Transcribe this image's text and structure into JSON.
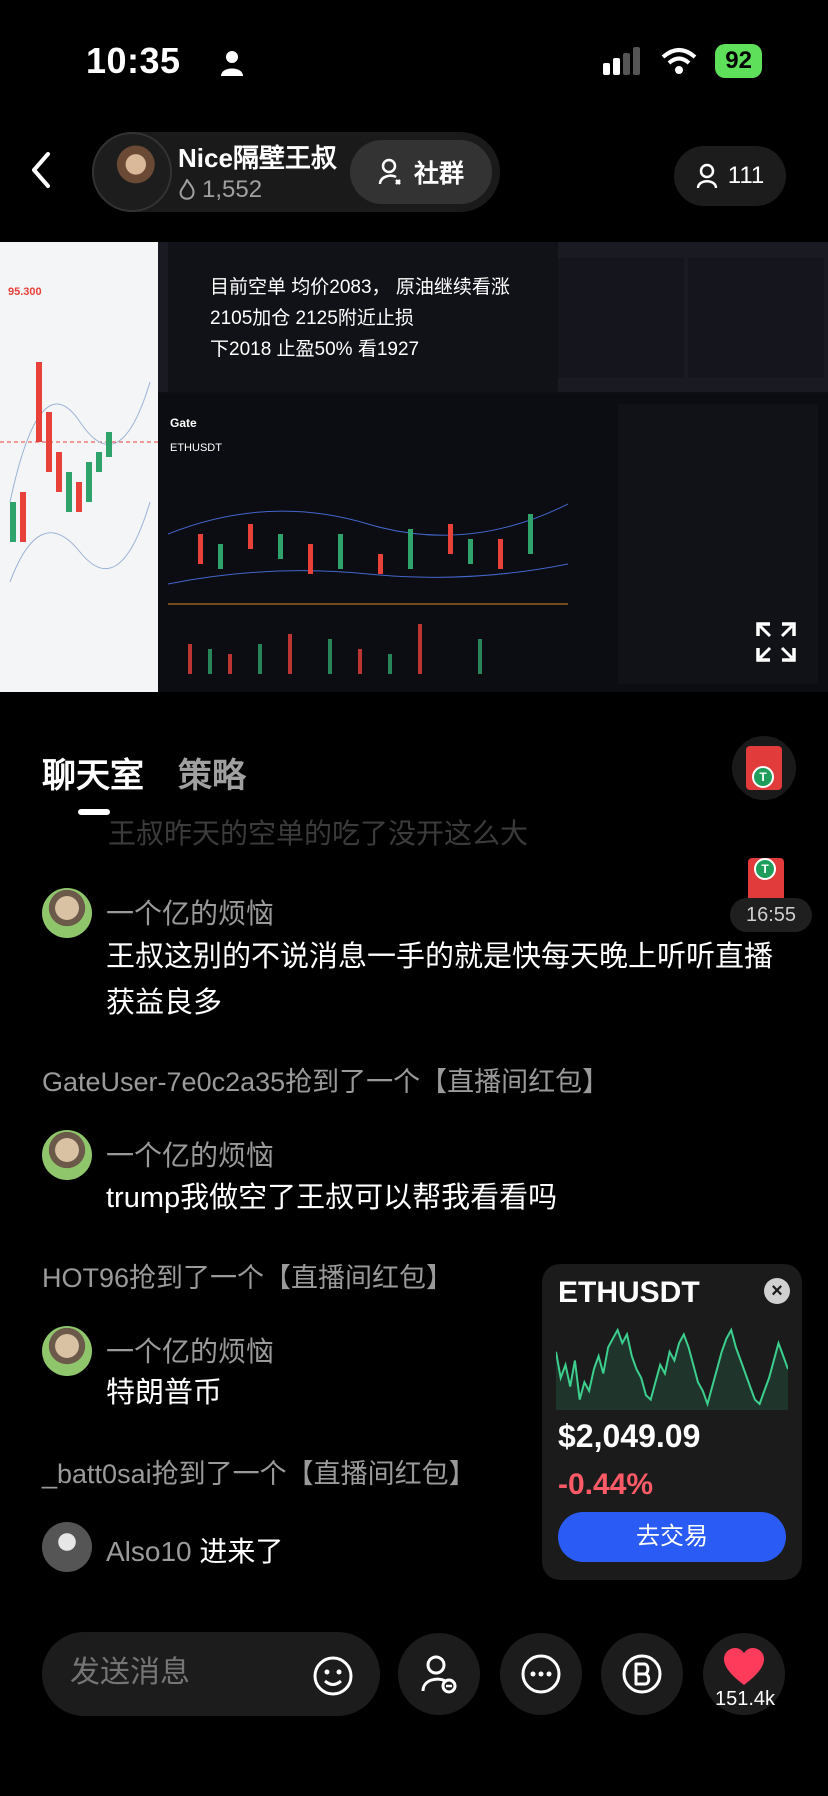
{
  "status_bar": {
    "time": "10:35",
    "battery": "92"
  },
  "host": {
    "name": "Nice隔壁王叔",
    "likes": "1,552",
    "community_label": "社群",
    "viewers": "111"
  },
  "stream": {
    "overlay_lines": [
      "目前空单 均价2083，   原油继续看涨",
      "2105加仓 2125附近止损",
      "下2018 止盈50% 看1927"
    ],
    "phone_price": "95.300",
    "pair": "ETHUSDT",
    "exchange": "Gate"
  },
  "tabs": {
    "chat": "聊天室",
    "strategy": "策略"
  },
  "timer": "16:55",
  "chat": {
    "faded_text": "王叔昨天的空单的吃了没开这么大",
    "messages": [
      {
        "user": "一个亿的烦恼",
        "lines": [
          "王叔这别的不说消息一手的就是快每天晚上听听直播",
          "获益良多"
        ]
      },
      {
        "system": "GateUser-7e0c2a35抢到了一个【直播间红包】"
      },
      {
        "user": "一个亿的烦恼",
        "lines": [
          "trump我做空了王叔可以帮我看看吗"
        ]
      },
      {
        "system": "HOT96抢到了一个【直播间红包】"
      },
      {
        "user": "一个亿的烦恼",
        "lines": [
          "特朗普币"
        ]
      },
      {
        "system": "_batt0sai抢到了一个【直播间红包】"
      }
    ],
    "join": {
      "user": "Also10",
      "action": "进来了"
    }
  },
  "ticker_card": {
    "symbol": "ETHUSDT",
    "price": "$2,049.09",
    "change": "-0.44%",
    "button": "去交易",
    "sparkline": [
      52,
      40,
      46,
      36,
      48,
      30,
      38,
      34,
      44,
      50,
      42,
      54,
      58,
      62,
      56,
      60,
      50,
      44,
      40,
      32,
      30,
      38,
      46,
      42,
      52,
      48,
      56,
      60,
      54,
      46,
      38,
      34,
      28,
      36,
      44,
      52,
      58,
      62,
      54,
      48,
      42,
      36,
      30,
      28,
      34,
      40,
      48,
      56,
      50,
      44
    ]
  },
  "bottom_bar": {
    "input_placeholder": "发送消息",
    "like_count": "151.4k"
  },
  "colors": {
    "accent": "#2a5bf5",
    "negative": "#ff5a67",
    "up": "#3ccf8e",
    "battery": "#5ee05a"
  }
}
